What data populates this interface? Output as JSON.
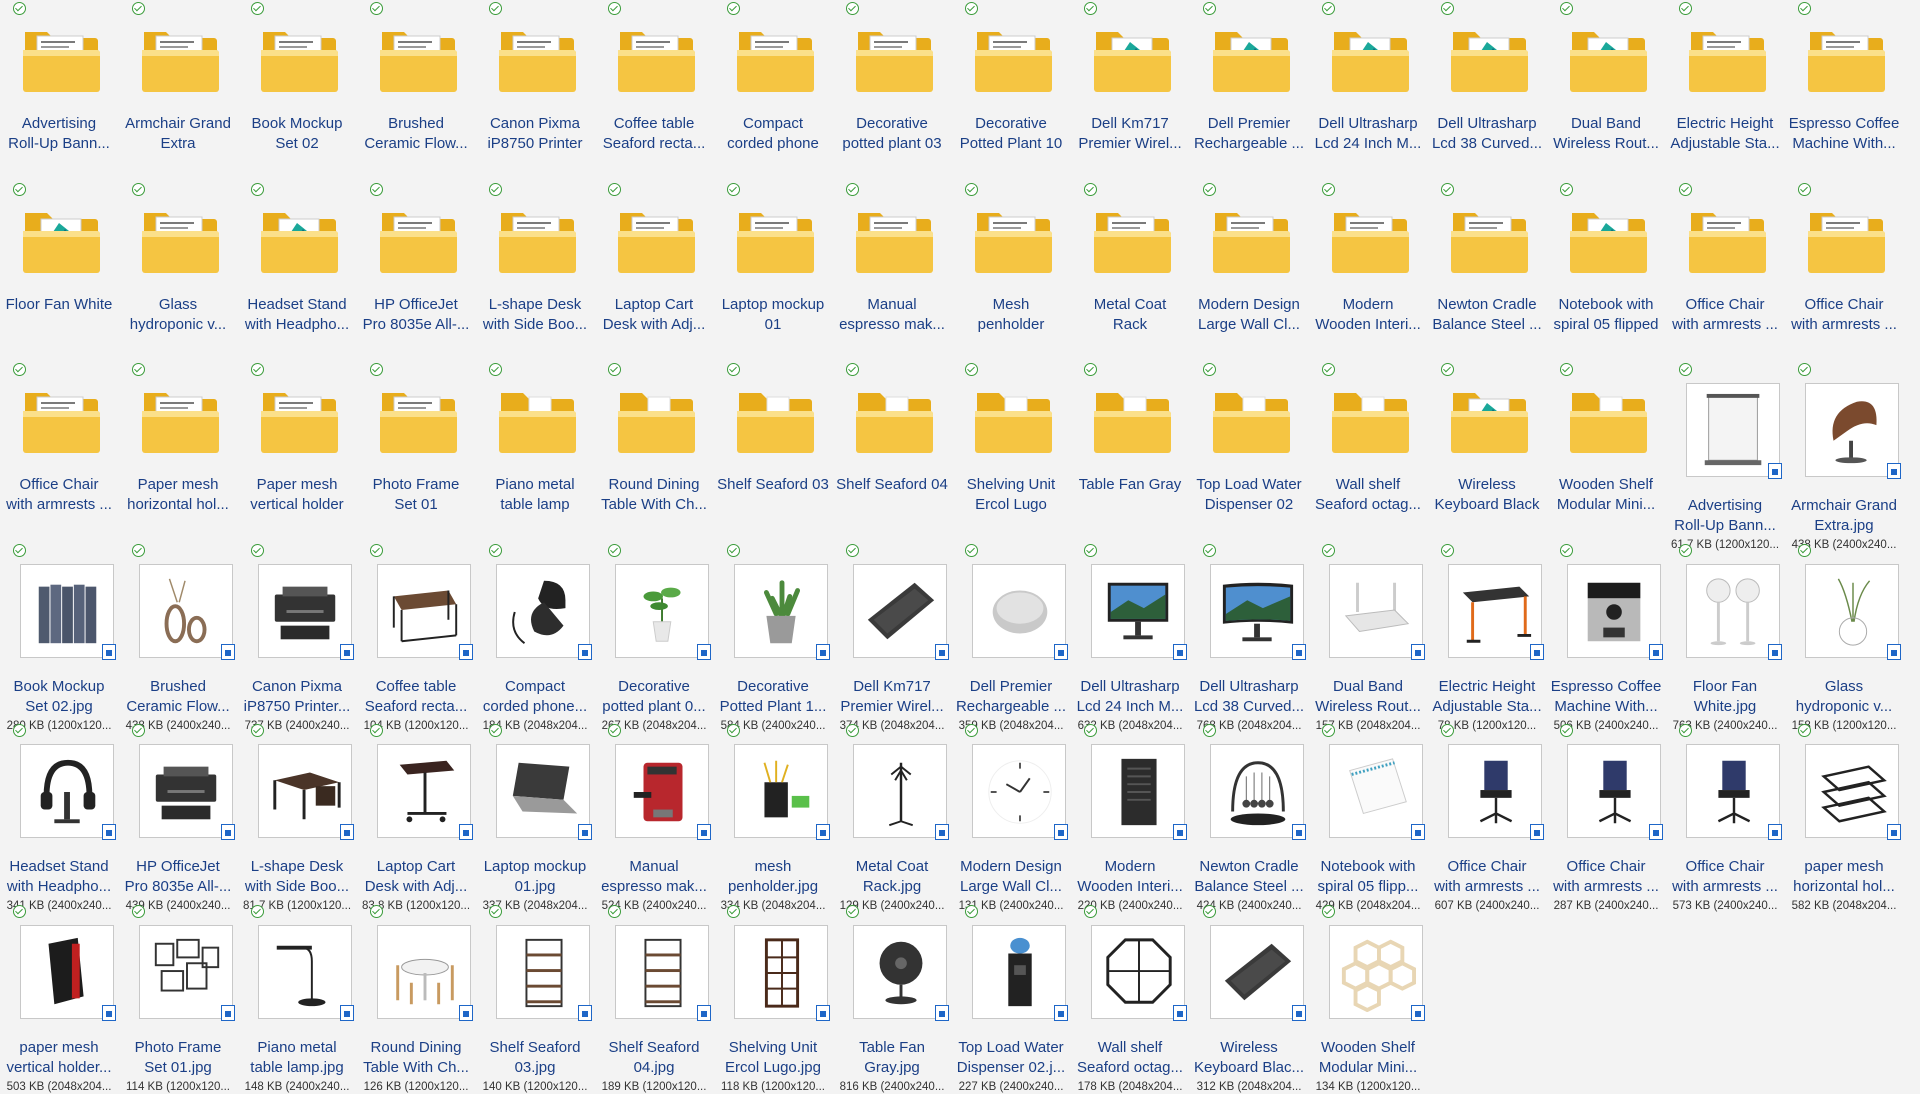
{
  "folders": [
    {
      "l1": "Advertising",
      "l2": "Roll-Up Bann...",
      "icon": "folder-icon"
    },
    {
      "l1": "Armchair Grand",
      "l2": "Extra",
      "icon": "folder-icon"
    },
    {
      "l1": "Book Mockup",
      "l2": "Set 02",
      "icon": "folder-icon"
    },
    {
      "l1": "Brushed",
      "l2": "Ceramic Flow...",
      "icon": "folder-icon"
    },
    {
      "l1": "Canon Pixma",
      "l2": "iP8750 Printer",
      "icon": "folder-icon"
    },
    {
      "l1": "Coffee table",
      "l2": "Seaford recta...",
      "icon": "folder-icon"
    },
    {
      "l1": "Compact",
      "l2": "corded phone",
      "icon": "folder-icon"
    },
    {
      "l1": "Decorative",
      "l2": "potted plant 03",
      "icon": "folder-icon"
    },
    {
      "l1": "Decorative",
      "l2": "Potted Plant 10",
      "icon": "folder-icon"
    },
    {
      "l1": "Dell Km717",
      "l2": "Premier Wirel...",
      "icon": "folder-image-icon"
    },
    {
      "l1": "Dell Premier",
      "l2": "Rechargeable ...",
      "icon": "folder-image-icon"
    },
    {
      "l1": "Dell Ultrasharp",
      "l2": "Lcd 24 Inch M...",
      "icon": "folder-image-icon"
    },
    {
      "l1": "Dell Ultrasharp",
      "l2": "Lcd 38 Curved...",
      "icon": "folder-image-icon"
    },
    {
      "l1": "Dual Band",
      "l2": "Wireless Rout...",
      "icon": "folder-image-icon"
    },
    {
      "l1": "Electric Height",
      "l2": "Adjustable Sta...",
      "icon": "folder-icon"
    },
    {
      "l1": "Espresso Coffee",
      "l2": "Machine With...",
      "icon": "folder-icon"
    },
    {
      "l1": "Floor Fan White",
      "l2": "",
      "icon": "folder-image-icon"
    },
    {
      "l1": "Glass",
      "l2": "hydroponic v...",
      "icon": "folder-icon"
    },
    {
      "l1": "Headset Stand",
      "l2": "with Headpho...",
      "icon": "folder-image-icon"
    },
    {
      "l1": "HP OfficeJet",
      "l2": "Pro 8035e All-...",
      "icon": "folder-icon"
    },
    {
      "l1": "L-shape Desk",
      "l2": "with Side Boo...",
      "icon": "folder-icon"
    },
    {
      "l1": "Laptop Cart",
      "l2": "Desk with Adj...",
      "icon": "folder-icon"
    },
    {
      "l1": "Laptop mockup",
      "l2": "01",
      "icon": "folder-icon"
    },
    {
      "l1": "Manual",
      "l2": "espresso mak...",
      "icon": "folder-icon"
    },
    {
      "l1": "Mesh",
      "l2": "penholder",
      "icon": "folder-icon"
    },
    {
      "l1": "Metal Coat",
      "l2": "Rack",
      "icon": "folder-icon"
    },
    {
      "l1": "Modern Design",
      "l2": "Large Wall Cl...",
      "icon": "folder-icon"
    },
    {
      "l1": "Modern",
      "l2": "Wooden Interi...",
      "icon": "folder-icon"
    },
    {
      "l1": "Newton Cradle",
      "l2": "Balance Steel ...",
      "icon": "folder-icon"
    },
    {
      "l1": "Notebook with",
      "l2": "spiral 05 flipped",
      "icon": "folder-image-icon"
    },
    {
      "l1": "Office Chair",
      "l2": "with armrests ...",
      "icon": "folder-icon"
    },
    {
      "l1": "Office Chair",
      "l2": "with armrests ...",
      "icon": "folder-icon"
    },
    {
      "l1": "Office Chair",
      "l2": "with armrests ...",
      "icon": "folder-icon"
    },
    {
      "l1": "Paper mesh",
      "l2": "horizontal hol...",
      "icon": "folder-icon"
    },
    {
      "l1": "Paper mesh",
      "l2": "vertical holder",
      "icon": "folder-icon"
    },
    {
      "l1": "Photo Frame",
      "l2": "Set 01",
      "icon": "folder-icon"
    },
    {
      "l1": "Piano metal",
      "l2": "table lamp",
      "icon": "folder-empty-icon"
    },
    {
      "l1": "Round Dining",
      "l2": "Table With Ch...",
      "icon": "folder-empty-icon"
    },
    {
      "l1": "Shelf Seaford 03",
      "l2": "",
      "icon": "folder-empty-icon"
    },
    {
      "l1": "Shelf Seaford 04",
      "l2": "",
      "icon": "folder-empty-icon"
    },
    {
      "l1": "Shelving Unit",
      "l2": "Ercol Lugo",
      "icon": "folder-empty-icon"
    },
    {
      "l1": "Table Fan Gray",
      "l2": "",
      "icon": "folder-empty-icon"
    },
    {
      "l1": "Top Load Water",
      "l2": "Dispenser 02",
      "icon": "folder-empty-icon"
    },
    {
      "l1": "Wall shelf",
      "l2": "Seaford octag...",
      "icon": "folder-empty-icon"
    },
    {
      "l1": "Wireless",
      "l2": "Keyboard Black",
      "icon": "folder-image-icon"
    },
    {
      "l1": "Wooden Shelf",
      "l2": "Modular Mini...",
      "icon": "folder-empty-icon"
    }
  ],
  "images": [
    {
      "l1": "Advertising",
      "l2": "Roll-Up Bann...",
      "meta": "61.7 KB (1200x120...",
      "icon": "rollup-banner-icon"
    },
    {
      "l1": "Armchair Grand",
      "l2": "Extra.jpg",
      "meta": "438 KB (2400x240...",
      "icon": "armchair-icon"
    },
    {
      "l1": "Book Mockup",
      "l2": "Set 02.jpg",
      "meta": "280 KB (1200x120...",
      "icon": "books-icon"
    },
    {
      "l1": "Brushed",
      "l2": "Ceramic Flow...",
      "meta": "438 KB (2400x240...",
      "icon": "vase-icon"
    },
    {
      "l1": "Canon Pixma",
      "l2": "iP8750 Printer...",
      "meta": "737 KB (2400x240...",
      "icon": "printer-icon"
    },
    {
      "l1": "Coffee table",
      "l2": "Seaford recta...",
      "meta": "104 KB (1200x120...",
      "icon": "coffee-table-icon"
    },
    {
      "l1": "Compact",
      "l2": "corded phone...",
      "meta": "184 KB (2048x204...",
      "icon": "phone-icon"
    },
    {
      "l1": "Decorative",
      "l2": "potted plant 0...",
      "meta": "267 KB (2048x204...",
      "icon": "plant-icon"
    },
    {
      "l1": "Decorative",
      "l2": "Potted Plant 1...",
      "meta": "584 KB (2400x240...",
      "icon": "succulent-icon"
    },
    {
      "l1": "Dell Km717",
      "l2": "Premier Wirel...",
      "meta": "374 KB (2048x204...",
      "icon": "keyboard-icon"
    },
    {
      "l1": "Dell Premier",
      "l2": "Rechargeable ...",
      "meta": "359 KB (2048x204...",
      "icon": "mouse-icon"
    },
    {
      "l1": "Dell Ultrasharp",
      "l2": "Lcd 24 Inch M...",
      "meta": "632 KB (2048x204...",
      "icon": "monitor-icon"
    },
    {
      "l1": "Dell Ultrasharp",
      "l2": "Lcd 38 Curved...",
      "meta": "768 KB (2048x204...",
      "icon": "curved-monitor-icon"
    },
    {
      "l1": "Dual Band",
      "l2": "Wireless Rout...",
      "meta": "157 KB (2048x204...",
      "icon": "router-icon"
    },
    {
      "l1": "Electric Height",
      "l2": "Adjustable Sta...",
      "meta": "78 KB (1200x120...",
      "icon": "standing-desk-icon"
    },
    {
      "l1": "Espresso Coffee",
      "l2": "Machine With...",
      "meta": "506 KB (2400x240...",
      "icon": "espresso-machine-icon"
    },
    {
      "l1": "Floor Fan",
      "l2": "White.jpg",
      "meta": "763 KB (2400x240...",
      "icon": "floor-fan-icon"
    },
    {
      "l1": "Glass",
      "l2": "hydroponic v...",
      "meta": "158 KB (1200x120...",
      "icon": "glass-vase-icon"
    },
    {
      "l1": "Headset Stand",
      "l2": "with Headpho...",
      "meta": "341 KB (2400x240...",
      "icon": "headset-icon"
    },
    {
      "l1": "HP OfficeJet",
      "l2": "Pro 8035e All-...",
      "meta": "439 KB (2400x240...",
      "icon": "printer-icon"
    },
    {
      "l1": "L-shape Desk",
      "l2": "with Side Boo...",
      "meta": "81.7 KB (1200x120...",
      "icon": "desk-icon"
    },
    {
      "l1": "Laptop Cart",
      "l2": "Desk with Adj...",
      "meta": "83.8 KB (1200x120...",
      "icon": "cart-desk-icon"
    },
    {
      "l1": "Laptop mockup",
      "l2": "01.jpg",
      "meta": "337 KB (2048x204...",
      "icon": "laptop-icon"
    },
    {
      "l1": "Manual",
      "l2": "espresso mak...",
      "meta": "524 KB (2400x240...",
      "icon": "espresso-maker-icon"
    },
    {
      "l1": "mesh",
      "l2": "penholder.jpg",
      "meta": "334 KB (2048x204...",
      "icon": "penholder-icon"
    },
    {
      "l1": "Metal Coat",
      "l2": "Rack.jpg",
      "meta": "129 KB (2400x240...",
      "icon": "coat-rack-icon"
    },
    {
      "l1": "Modern Design",
      "l2": "Large Wall Cl...",
      "meta": "131 KB (2400x240...",
      "icon": "wall-clock-icon"
    },
    {
      "l1": "Modern",
      "l2": "Wooden Interi...",
      "meta": "220 KB (2400x240...",
      "icon": "door-icon"
    },
    {
      "l1": "Newton Cradle",
      "l2": "Balance Steel ...",
      "meta": "424 KB (2400x240...",
      "icon": "newton-cradle-icon"
    },
    {
      "l1": "Notebook with",
      "l2": "spiral 05 flipp...",
      "meta": "429 KB (2048x204...",
      "icon": "notebook-icon"
    },
    {
      "l1": "Office Chair",
      "l2": "with armrests ...",
      "meta": "607 KB (2400x240...",
      "icon": "office-chair-icon"
    },
    {
      "l1": "Office Chair",
      "l2": "with armrests ...",
      "meta": "287 KB (2400x240...",
      "icon": "office-chair-icon"
    },
    {
      "l1": "Office Chair",
      "l2": "with armrests ...",
      "meta": "573 KB (2400x240...",
      "icon": "office-chair-icon"
    },
    {
      "l1": "paper mesh",
      "l2": "horizontal hol...",
      "meta": "582 KB (2048x204...",
      "icon": "paper-tray-icon"
    },
    {
      "l1": "paper mesh",
      "l2": "vertical holder...",
      "meta": "503 KB (2048x204...",
      "icon": "paper-holder-icon"
    },
    {
      "l1": "Photo Frame",
      "l2": "Set 01.jpg",
      "meta": "114 KB (1200x120...",
      "icon": "photo-frames-icon"
    },
    {
      "l1": "Piano metal",
      "l2": "table lamp.jpg",
      "meta": "148 KB (2400x240...",
      "icon": "lamp-icon"
    },
    {
      "l1": "Round Dining",
      "l2": "Table With Ch...",
      "meta": "126 KB (1200x120...",
      "icon": "dining-table-icon"
    },
    {
      "l1": "Shelf Seaford",
      "l2": "03.jpg",
      "meta": "140 KB (1200x120...",
      "icon": "shelf-icon"
    },
    {
      "l1": "Shelf Seaford",
      "l2": "04.jpg",
      "meta": "189 KB (1200x120...",
      "icon": "shelf-icon"
    },
    {
      "l1": "Shelving Unit",
      "l2": "Ercol Lugo.jpg",
      "meta": "118 KB (1200x120...",
      "icon": "shelving-unit-icon"
    },
    {
      "l1": "Table Fan",
      "l2": "Gray.jpg",
      "meta": "816 KB (2400x240...",
      "icon": "table-fan-icon"
    },
    {
      "l1": "Top Load Water",
      "l2": "Dispenser 02.j...",
      "meta": "227 KB (2400x240...",
      "icon": "water-dispenser-icon"
    },
    {
      "l1": "Wall shelf",
      "l2": "Seaford octag...",
      "meta": "178 KB (2048x204...",
      "icon": "octagon-shelf-icon"
    },
    {
      "l1": "Wireless",
      "l2": "Keyboard Blac...",
      "meta": "312 KB (2048x204...",
      "icon": "keyboard-icon"
    },
    {
      "l1": "Wooden Shelf",
      "l2": "Modular Mini...",
      "meta": "134 KB (1200x120...",
      "icon": "hex-shelf-icon"
    }
  ],
  "colors": {
    "label": "#1b3f86",
    "check": "#3b9c3b",
    "folder": "#f5c542",
    "folder_dark": "#e8ad1c",
    "thumb_border": "#c8c8c8"
  }
}
